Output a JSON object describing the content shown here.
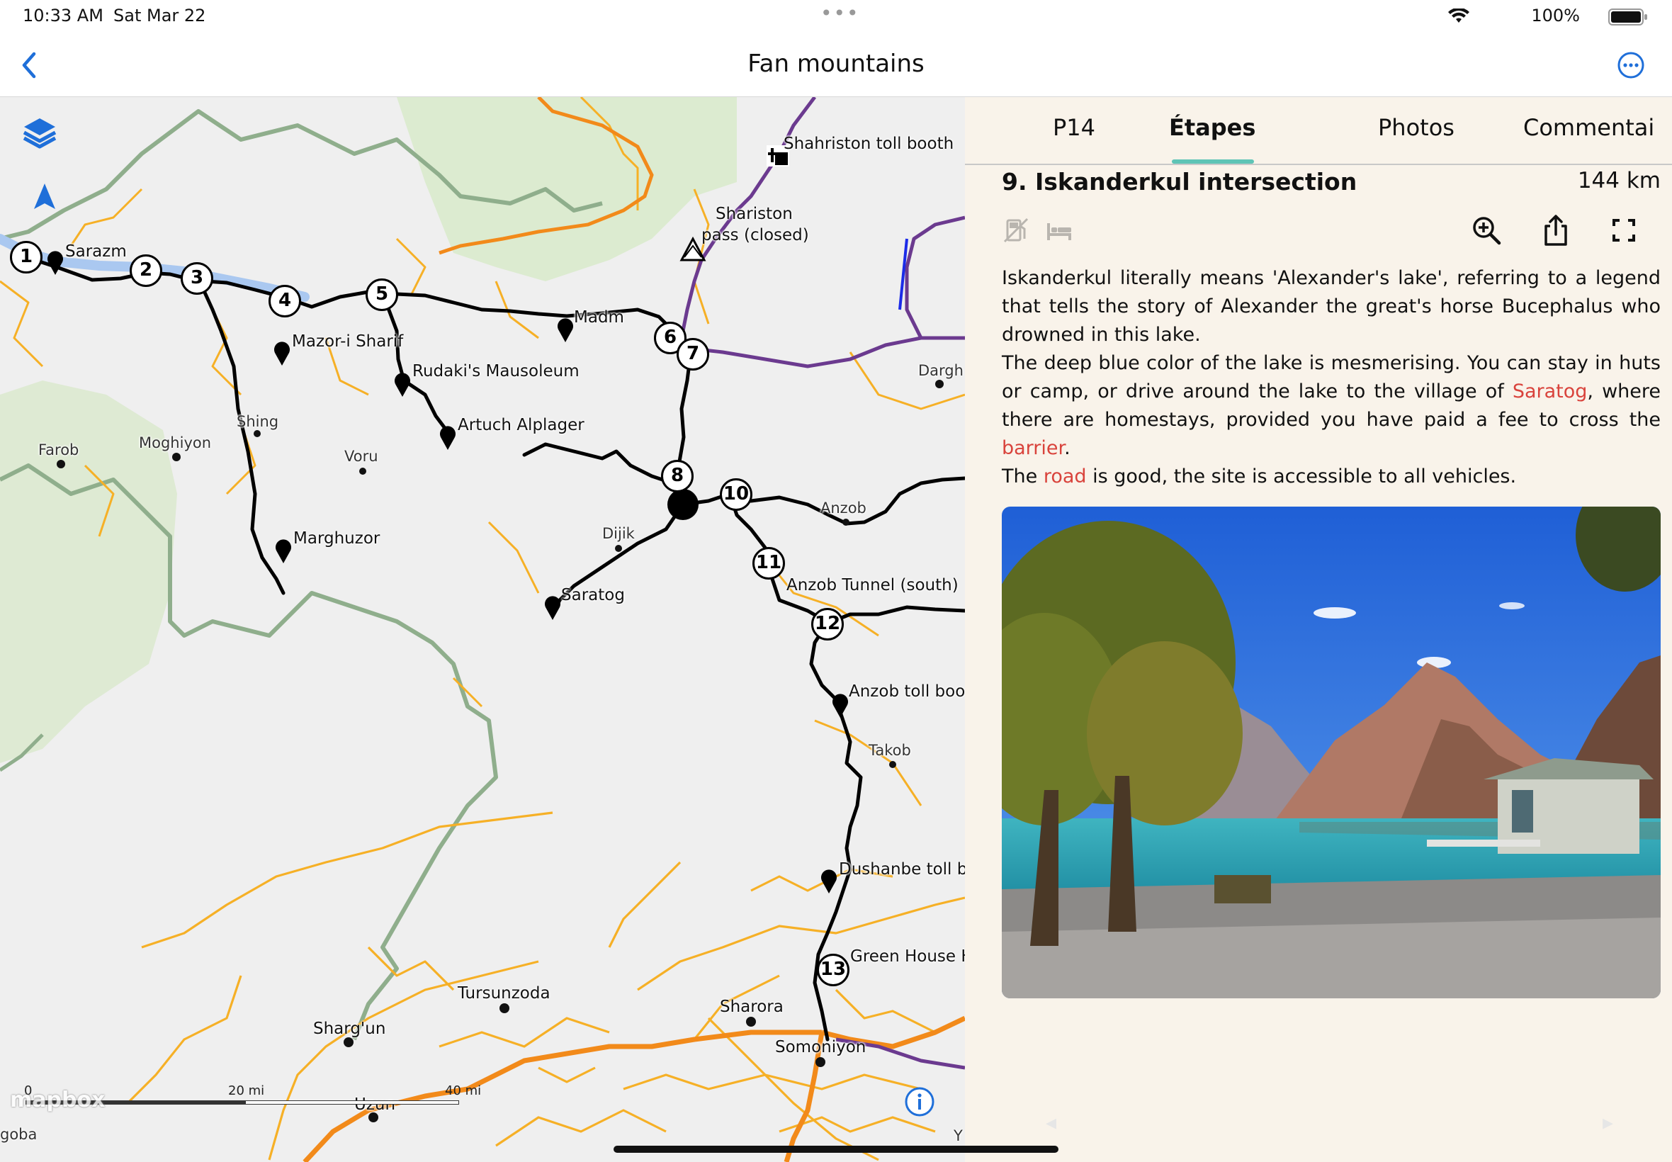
{
  "status_bar": {
    "time": "10:33 AM",
    "date": "Sat Mar 22",
    "battery": "100%",
    "multitask_dots": "•••"
  },
  "nav": {
    "title": "Fan mountains",
    "back_icon": "chevron-left-icon",
    "more_icon": "ellipsis-circle-icon",
    "accent_color": "#1f6fd9"
  },
  "map": {
    "stage_markers": [
      "1",
      "2",
      "3",
      "4",
      "5",
      "6",
      "7",
      "8",
      "10",
      "11",
      "12",
      "13"
    ],
    "poi_labels": {
      "sarazm": "Sarazm",
      "mazor": "Mazor-i Sharif",
      "rudaki": "Rudaki's Mausoleum",
      "artuch": "Artuch Alplager",
      "madm": "Madm",
      "marghuzor": "Marghuzor",
      "saratog": "Saratog",
      "anzob_tunnel": "Anzob Tunnel (south)",
      "anzob_toll": "Anzob toll bootl",
      "dushanbe_toll": "Dushanbe toll bo",
      "green_house": "Green House H",
      "shahriston_toll": "Shahriston toll booth",
      "shariston_pass_1": "Shariston",
      "shariston_pass_2": "pass (closed)"
    },
    "place_labels": {
      "farob": "Farob",
      "moghiyon": "Moghiyon",
      "shing": "Shing",
      "voru": "Voru",
      "dijik": "Dijik",
      "anzob": "Anzob",
      "dargh": "Dargh",
      "takob": "Takob",
      "tursunzoda": "Tursunzoda",
      "sharora": "Sharora",
      "shargun": "Sharg'un",
      "somoniyon": "Somoniyon",
      "uzun": "Uzun",
      "goba": "goba",
      "y": "Y"
    },
    "scale": {
      "zero": "0",
      "mid": "20 mi",
      "end": "40 mi"
    },
    "attribution": "mapbox",
    "icons": {
      "layers": "layers-icon",
      "locate": "location-arrow-icon",
      "info": "info-icon"
    },
    "colors": {
      "route": "#000000",
      "roads": "#f6b026",
      "highway": "#f28a1a",
      "border": "#8fae8c",
      "water": "#aac8f0",
      "park": "#dcebd0"
    }
  },
  "panel": {
    "tabs": [
      {
        "label": "P14",
        "active": false
      },
      {
        "label": "Étapes",
        "active": true
      },
      {
        "label": "Photos",
        "active": false
      },
      {
        "label": "Commentai",
        "active": false
      }
    ],
    "stage": {
      "title": "9. Iskanderkul intersection",
      "distance": "144 km"
    },
    "amenity_icons": [
      "fuel-icon",
      "bed-icon"
    ],
    "action_icons": [
      "zoom-in-icon",
      "share-icon",
      "fullscreen-icon"
    ],
    "description": {
      "p1": "Iskanderkul literally means 'Alexander's lake', referring to a legend that tells the story of Alexander the great's horse Bucephalus who drowned in this lake.",
      "p2_a": "The deep blue color of the lake is mesmerising. You can stay in huts or camp, or drive around the lake to the village of ",
      "p2_link1": "Saratog",
      "p2_b": ", where there are homestays, provided you have paid a fee to cross the ",
      "p2_link2": "barrier",
      "p2_c": ".",
      "p3_a": "The ",
      "p3_link": "road",
      "p3_b": " is good, the site is accessible to all vehicles."
    },
    "link_color": "#d9433c",
    "active_tab_color": "#5ec4b6",
    "background": "#f9f3ea",
    "pager": {
      "prev": "◂",
      "next": "▸"
    }
  }
}
